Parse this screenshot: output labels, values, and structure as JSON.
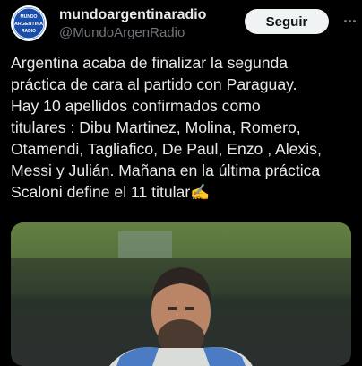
{
  "tweet": {
    "author": {
      "display_name": "mundoargentinaradio",
      "handle": "@MundoArgenRadio",
      "avatar_text": [
        "MUNDO",
        "ARGENTINA",
        "RADIO"
      ]
    },
    "follow_label": "Seguir",
    "text_lines": [
      "Argentina acaba de finalizar la segunda",
      "práctica de cara al partido con Paraguay.",
      "Hay 10 apellidos confirmados como",
      "titulares : Dibu Martinez, Molina, Romero,",
      "Otamendi, Tagliafico, De Paul, Enzo , Alexis,",
      "Messi y Julián. Mañana en la última práctica",
      "Scaloni define el 11 titular✍️"
    ]
  },
  "icons": {
    "more": "more-options-icon"
  },
  "colors": {
    "background": "#000000",
    "text": "#e7e9ea",
    "secondary_text": "#71767b",
    "follow_button_bg": "#eff3f4",
    "avatar_blue": "#1a4ea8"
  }
}
